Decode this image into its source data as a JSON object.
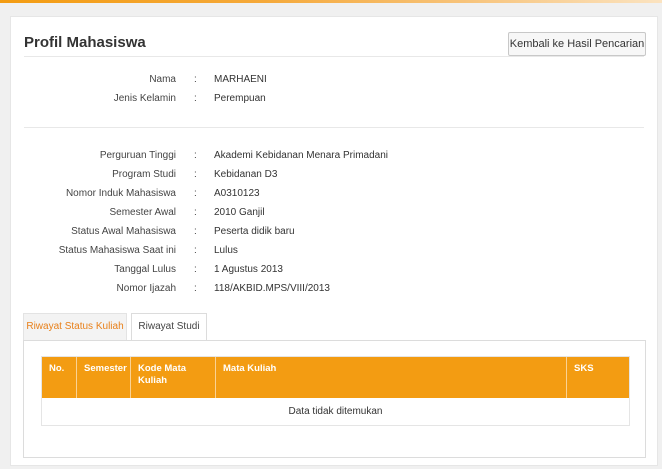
{
  "page": {
    "title": "Profil Mahasiswa",
    "back_button": "Kembali ke Hasil Pencarian"
  },
  "personal": [
    {
      "label": "Nama",
      "sep": ":",
      "value": "MARHAENI"
    },
    {
      "label": "Jenis Kelamin",
      "sep": ":",
      "value": "Perempuan"
    }
  ],
  "academic": [
    {
      "label": "Perguruan Tinggi",
      "sep": ":",
      "value": "Akademi Kebidanan Menara Primadani"
    },
    {
      "label": "Program Studi",
      "sep": ":",
      "value": "Kebidanan D3"
    },
    {
      "label": "Nomor Induk Mahasiswa",
      "sep": ":",
      "value": "A0310123"
    },
    {
      "label": "Semester Awal",
      "sep": ":",
      "value": "2010 Ganjil"
    },
    {
      "label": "Status Awal Mahasiswa",
      "sep": ":",
      "value": "Peserta didik baru"
    },
    {
      "label": "Status Mahasiswa Saat ini",
      "sep": ":",
      "value": "Lulus"
    },
    {
      "label": "Tanggal Lulus",
      "sep": ":",
      "value": "1 Agustus 2013"
    },
    {
      "label": "Nomor Ijazah",
      "sep": ":",
      "value": "118/AKBID.MPS/VIII/2013"
    }
  ],
  "tabs": [
    {
      "label": "Riwayat Status Kuliah"
    },
    {
      "label": "Riwayat Studi"
    }
  ],
  "table": {
    "headers": [
      "No.",
      "Semester",
      "Kode Mata Kuliah",
      "Mata Kuliah",
      "SKS"
    ],
    "empty_text": "Data tidak ditemukan"
  },
  "colors": {
    "accent": "#f39c12",
    "active_tab_text": "#e8801a"
  }
}
